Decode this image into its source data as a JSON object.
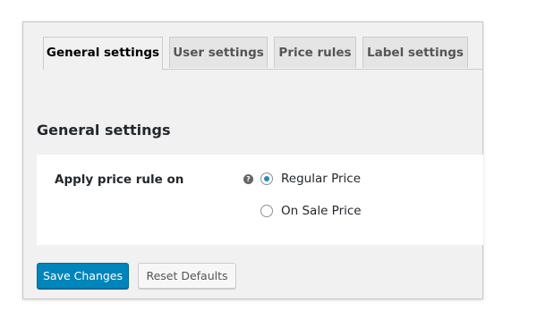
{
  "tabs": [
    {
      "label": "General settings",
      "active": true
    },
    {
      "label": "User settings",
      "active": false
    },
    {
      "label": "Price rules",
      "active": false
    },
    {
      "label": "Label settings",
      "active": false
    }
  ],
  "section": {
    "title": "General settings"
  },
  "field": {
    "label": "Apply price rule on",
    "help_icon": "question-mark-icon",
    "options": [
      {
        "label": "Regular Price",
        "checked": true
      },
      {
        "label": "On Sale Price",
        "checked": false
      }
    ]
  },
  "buttons": {
    "save_label": "Save Changes",
    "reset_label": "Reset Defaults"
  },
  "colors": {
    "primary": "#0085ba",
    "radio_selected": "#1e8cbe",
    "background": "#f1f1f1"
  }
}
